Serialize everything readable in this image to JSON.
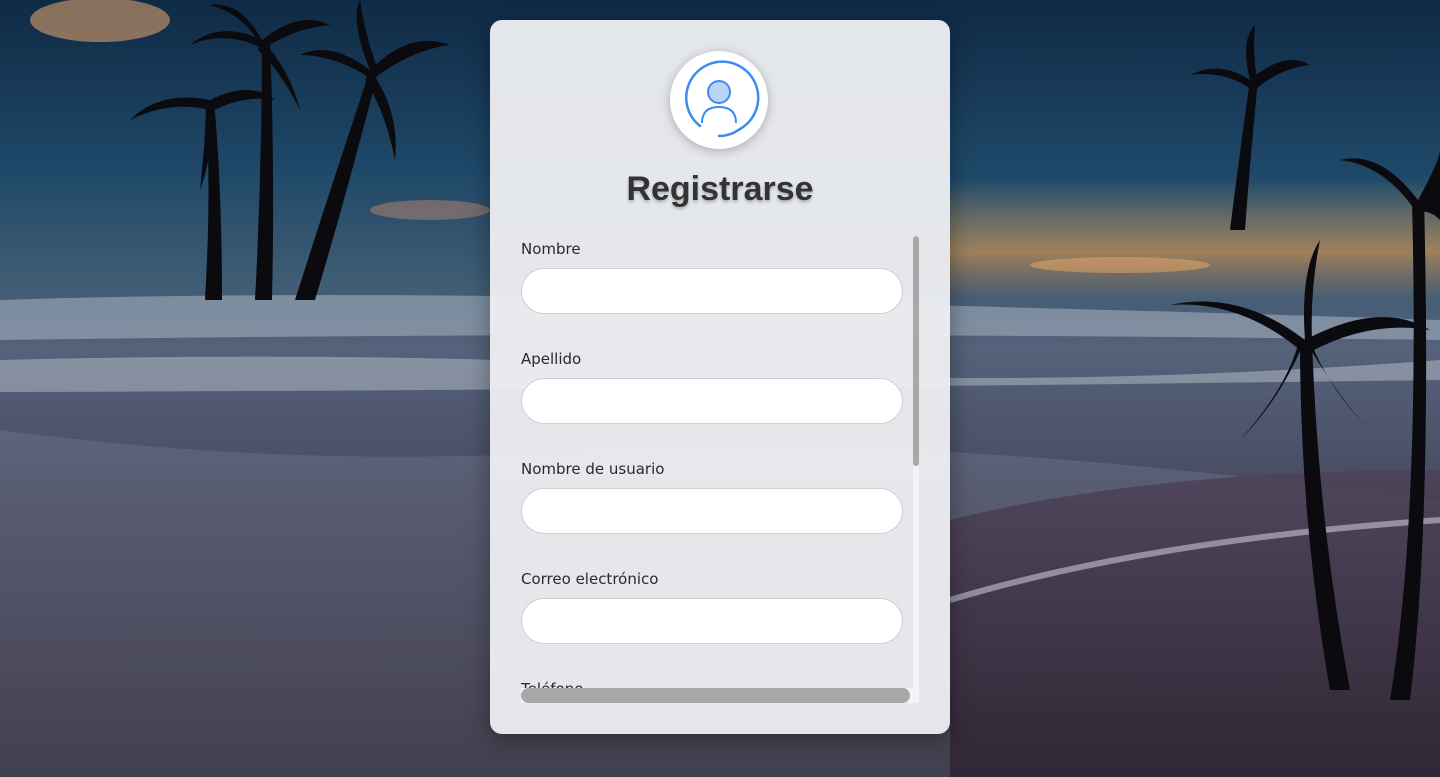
{
  "form": {
    "title": "Registrarse",
    "avatar_icon": "user-circle-icon",
    "fields": [
      {
        "label": "Nombre",
        "value": "",
        "placeholder": ""
      },
      {
        "label": "Apellido",
        "value": "",
        "placeholder": ""
      },
      {
        "label": "Nombre de usuario",
        "value": "",
        "placeholder": ""
      },
      {
        "label": "Correo electrónico",
        "value": "",
        "placeholder": ""
      },
      {
        "label": "Teléfono",
        "value": "",
        "placeholder": ""
      }
    ]
  },
  "colors": {
    "accent": "#3d8bf2",
    "title": "#333333",
    "card": "#ecedf0"
  }
}
